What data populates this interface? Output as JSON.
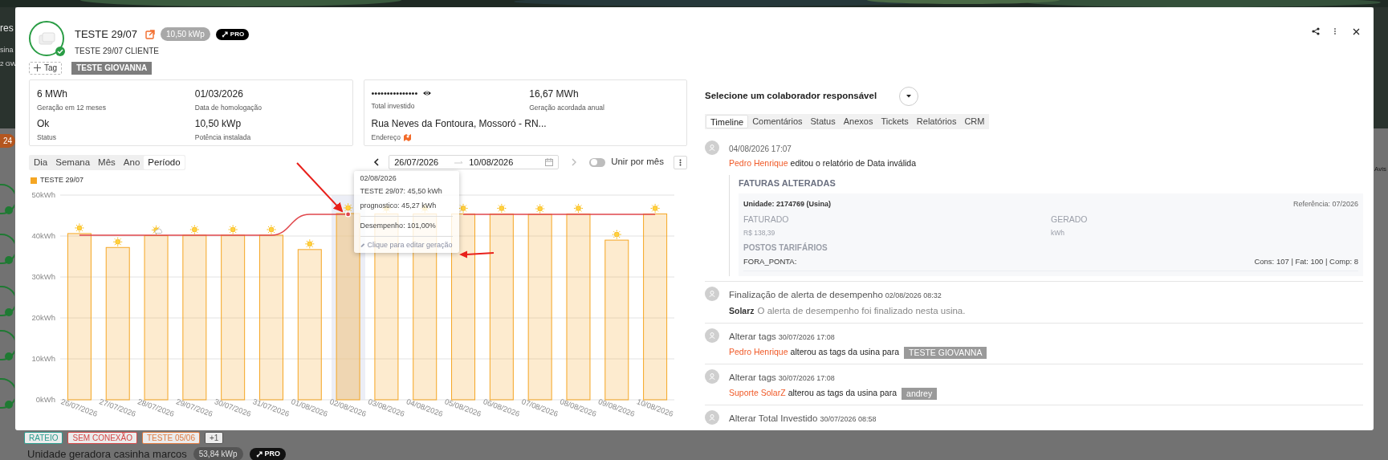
{
  "background": {
    "fragments": [
      {
        "kind": "title",
        "text": "res"
      },
      {
        "kind": "sub",
        "text": "sina"
      },
      {
        "kind": "sub2",
        "text": "2 GW"
      },
      {
        "kind": "count",
        "text": "24"
      },
      {
        "kind": "right",
        "text": "Avis"
      }
    ],
    "tags": [
      {
        "text": "RATEIO",
        "color": "#2a9d8f"
      },
      {
        "text": "SEM CONEXÃO",
        "color": "#d64545"
      },
      {
        "text": "TESTE 05/06",
        "color": "#e07a3f"
      },
      {
        "text": "+1",
        "color": "#555555"
      }
    ],
    "unit": {
      "name": "Unidade geradora casinha marcos",
      "power": "53,84 kWp",
      "badge": "PRO"
    }
  },
  "plant": {
    "name": "TESTE 29/07",
    "client": "TESTE 29/07 CLIENTE",
    "power": "10,50 kWp",
    "badge": "PRO",
    "online": true
  },
  "tags": {
    "add_label": "Tag",
    "items": [
      "TESTE GIOVANNA"
    ]
  },
  "info_cards": [
    {
      "fields": [
        {
          "kind": "plain",
          "value": "6 MWh",
          "label": "Geração em 12 meses"
        },
        {
          "kind": "plain",
          "value": "01/03/2026",
          "label": "Data de homologação"
        },
        {
          "kind": "plain",
          "value": "Ok",
          "label": "Status"
        },
        {
          "kind": "plain",
          "value": "10,50 kWp",
          "label": "Potência instalada"
        }
      ]
    },
    {
      "fields": [
        {
          "kind": "secret",
          "value": "•••••••••••••••",
          "label": "Total investido"
        },
        {
          "kind": "plain",
          "value": "16,67 MWh",
          "label": "Geração acordada anual"
        },
        {
          "kind": "address",
          "value": "Rua Neves da Fontoura, Mossoró - RN...",
          "label": "Endereço"
        }
      ]
    }
  ],
  "periods": [
    {
      "label": "Dia",
      "selected": false
    },
    {
      "label": "Semana",
      "selected": false
    },
    {
      "label": "Mês",
      "selected": false
    },
    {
      "label": "Ano",
      "selected": false
    },
    {
      "label": "Período",
      "selected": true
    }
  ],
  "date_range": {
    "start": "26/07/2026",
    "end": "10/08/2026"
  },
  "merge_toggle": {
    "label": "Unir por mês",
    "on": false
  },
  "chart": {
    "chart_data": {
      "type": "bar",
      "categories": [
        "26/07/2026",
        "27/07/2026",
        "28/07/2026",
        "29/07/2026",
        "30/07/2026",
        "31/07/2026",
        "01/08/2026",
        "02/08/2026",
        "03/08/2026",
        "04/08/2026",
        "05/08/2026",
        "06/08/2026",
        "07/08/2026",
        "08/08/2026",
        "09/08/2026",
        "10/08/2026"
      ],
      "series": [
        {
          "name": "TESTE 29/07",
          "color": "#f5a623",
          "values": [
            40.6,
            37.2,
            40.1,
            40.2,
            40.2,
            40.2,
            36.7,
            45.5,
            45.4,
            45.4,
            45.4,
            45.4,
            45.3,
            45.4,
            39.0,
            45.4
          ]
        },
        {
          "color": "#e0474c",
          "type": "line",
          "values": [
            40.2,
            40.2,
            40.2,
            40.2,
            40.2,
            40.2,
            45.3,
            45.3,
            null,
            null,
            45.3,
            45.3,
            45.3,
            45.3,
            45.3,
            45.3
          ]
        }
      ],
      "grid": true,
      "ylim": [
        0,
        50
      ],
      "yticks": [
        {
          "value": 0,
          "label": "0kWh"
        },
        {
          "value": 10,
          "label": "10kWh"
        },
        {
          "value": 20,
          "label": "20kWh"
        },
        {
          "value": 30,
          "label": "30kWh"
        },
        {
          "value": 40,
          "label": "40kWh"
        },
        {
          "value": 50,
          "label": "50kWh"
        }
      ],
      "xlabel": null
    },
    "weather": [
      {
        "kind": "sun"
      },
      {
        "kind": "sun"
      },
      {
        "kind": "cloud"
      },
      {
        "kind": "sun"
      },
      {
        "kind": "sun"
      },
      {
        "kind": "sun"
      },
      {
        "kind": "sun"
      },
      {
        "kind": "sun"
      },
      {
        "kind": "sun"
      },
      {
        "kind": "sun"
      },
      {
        "kind": "sun"
      },
      {
        "kind": "sun"
      },
      {
        "kind": "sun"
      },
      {
        "kind": "sun"
      },
      {
        "kind": "sun"
      },
      {
        "kind": "sun"
      }
    ],
    "tooltip": {
      "date": "02/08/2026",
      "lines": [
        "TESTE 29/07: 45,50 kWh",
        "prognostico: 45,27 kWh"
      ],
      "performance": "Desempenho: 101,00%",
      "edit_hint": "Clique para editar geração"
    }
  },
  "responsible": {
    "label": "Selecione um colaborador responsável"
  },
  "tabs": [
    {
      "label": "Timeline",
      "selected": true
    },
    {
      "label": "Comentários",
      "selected": false
    },
    {
      "label": "Status",
      "selected": false
    },
    {
      "label": "Anexos",
      "selected": false
    },
    {
      "label": "Tickets",
      "selected": false
    },
    {
      "label": "Relatórios",
      "selected": false
    },
    {
      "label": "CRM",
      "selected": false
    }
  ],
  "timeline": [
    {
      "kind": "report",
      "date": "04/08/2026 17:07",
      "actor": {
        "name": "Pedro Henrique",
        "color": "#f05a28"
      },
      "text": "editou o relatório de Data inválida",
      "details": {
        "title": "FATURAS ALTERADAS",
        "unit": "Unidade: 2174769 (Usina)",
        "reference": "Referência: 07/2026",
        "columns": [
          {
            "label": "FATURADO",
            "value": "R$ 138,39"
          },
          {
            "label": "GERADO",
            "value": "kWh"
          }
        ],
        "section": "POSTOS TARIFÁRIOS",
        "rows": [
          {
            "label": "FORA_PONTA:",
            "value": "Cons: 107 | Fat: 100 | Comp: 8"
          }
        ]
      }
    },
    {
      "kind": "alert",
      "title": "Finalização de alerta de desempenho",
      "date": "02/08/2026 08:32",
      "actor": {
        "name": "Solarz",
        "color": "#333333"
      },
      "text": "O alerta de desempenho foi finalizado nesta usina."
    },
    {
      "kind": "tags",
      "title": "Alterar tags",
      "date": "30/07/2026 17:08",
      "actor": {
        "name": "Pedro Henrique",
        "color": "#f05a28"
      },
      "text": "alterou as tags da usina para",
      "tag": "TESTE GIOVANNA"
    },
    {
      "kind": "tags",
      "title": "Alterar tags",
      "date": "30/07/2026 17:08",
      "actor": {
        "name": "Suporte SolarZ",
        "color": "#f05a28"
      },
      "text": "alterou as tags da usina para",
      "tag": "andrey"
    },
    {
      "kind": "header",
      "title": "Alterar Total Investido",
      "date": "30/07/2026 08:58"
    }
  ]
}
